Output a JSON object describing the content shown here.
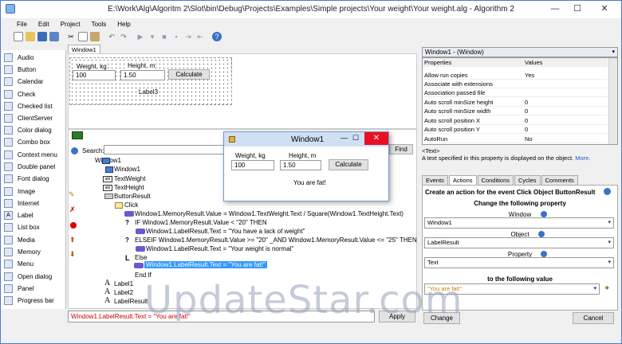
{
  "window": {
    "title": "E:\\Work\\Alg\\Algoritm 2\\Slot\\bin\\Debug\\Projects\\Examples\\Simple projects\\Your weight\\Your weight.alg - Algorithm 2",
    "minimize": "—",
    "maximize": "☐",
    "close": "✕"
  },
  "menu": [
    "File",
    "Edit",
    "Project",
    "Tools",
    "Help"
  ],
  "toolbar_icons": [
    "new-file-icon",
    "open-icon",
    "save-icon",
    "save-all-icon",
    "cut-icon",
    "copy-icon",
    "paste-icon",
    "undo-icon",
    "redo-icon",
    "run-icon",
    "pause-icon",
    "stop-icon",
    "step-icon",
    "step-over-icon",
    "step-out-icon",
    "help-icon"
  ],
  "sidebar": {
    "items": [
      "Audio",
      "Button",
      "Calendar",
      "Check",
      "Checked list",
      "ClientServer",
      "Color dialog",
      "Combo box",
      "Context menu",
      "Double panel",
      "Font dialog",
      "Image",
      "Internet",
      "Label",
      "List box",
      "Media",
      "Memory",
      "Menu",
      "Open dialog",
      "Panel",
      "Progress bar"
    ]
  },
  "designer": {
    "tab": "Window1",
    "weight_label": "Weight, kg",
    "weight_value": "100",
    "height_label": "Height, m",
    "height_value": "1.50",
    "calculate": "Calculate",
    "label3": "Label3"
  },
  "editor": {
    "search_label": "Search:",
    "find": "Find",
    "tree": [
      "Window1",
      "Window1",
      "TextWeight",
      "TextHeight",
      "ButtonResult",
      "Click",
      "Window1.MemoryResult.Value = Window1.TextWeight.Text / Square(Window1.TextHeight.Text)",
      "IF Window1.MemoryResult.Value < \"20\" THEN",
      "Window1.LabelResult.Text = \"You have a lack of weight\"",
      "ELSEIF Window1.MemoryResult.Value >= \"20\" _AND Window1.MemoryResult.Value <= \"25\" THEN",
      "Window1.LabelResult.Text = \"Your weight is normal\"",
      "Else",
      "Window1.LabelResult.Text = \"You are fat!\"",
      "End If",
      "Label1",
      "Label2",
      "LabelResult"
    ],
    "status_expr_black": "Window1.LabelResult.Text = ",
    "status_expr_quoted": "\"You are fat!\"",
    "apply": "Apply"
  },
  "popup": {
    "title": "Window1",
    "weight_label": "Weight, kg",
    "weight_value": "100",
    "height_label": "Height, m",
    "height_value": "1.50",
    "calculate": "Calculate",
    "result": "You are fat!"
  },
  "properties": {
    "header": "Window1 - (Window)",
    "col_properties": "Properties",
    "col_values": "Values",
    "rows": [
      {
        "name": "Allow run copies",
        "value": "Yes"
      },
      {
        "name": "Associate with extensions",
        "value": ""
      },
      {
        "name": "Association passed file",
        "value": ""
      },
      {
        "name": "Auto scroll minSize height",
        "value": "0"
      },
      {
        "name": "Auto scroll minSize width",
        "value": "0"
      },
      {
        "name": "Auto scroll position X",
        "value": "0"
      },
      {
        "name": "Auto scroll position Y",
        "value": "0"
      },
      {
        "name": "AutoRun",
        "value": "No"
      }
    ],
    "desc_title": "<Text>",
    "desc_text": "A text specified in this property is displayed on the object.",
    "desc_more": "More."
  },
  "tabs": [
    "Events",
    "Actions",
    "Conditions",
    "Cycles",
    "Comments"
  ],
  "actions": {
    "heading": "Create an action for the event Click Object ButtonResult",
    "subheading": "Change the following property",
    "window_label": "Window",
    "window_value": "Window1",
    "object_label": "Object",
    "object_value": "LabelResult",
    "property_label": "Property",
    "property_value": "Text",
    "value_heading": "to the following value",
    "value_value": "\"You are fat!\"",
    "change": "Change",
    "cancel": "Cancel"
  },
  "watermark": "UpdateStar.com",
  "colors": {
    "accent": "#3399ff",
    "close_red": "#e81123",
    "selection": "#3399ff"
  }
}
